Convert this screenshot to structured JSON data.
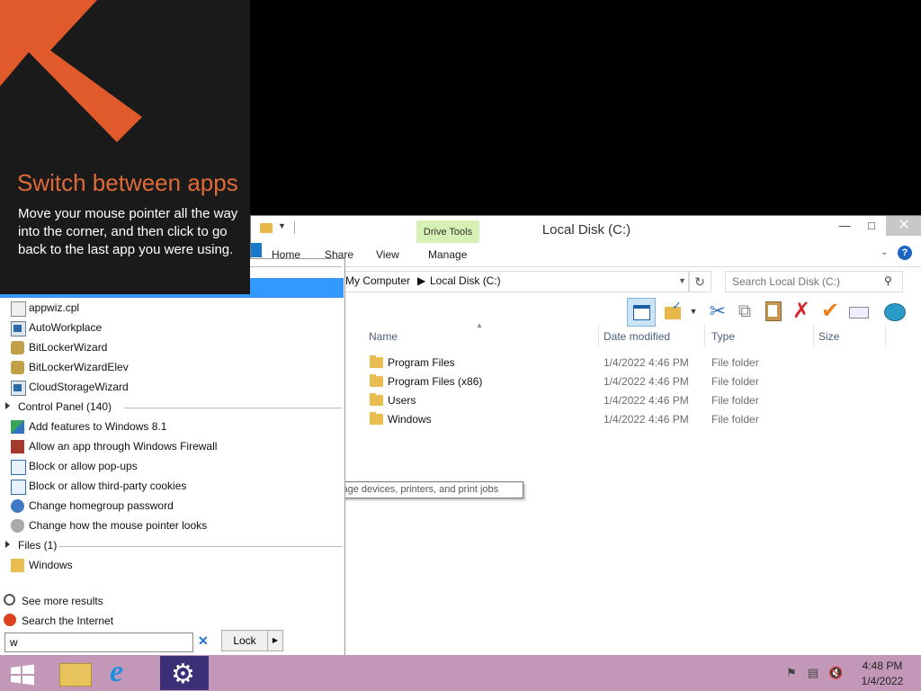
{
  "tip": {
    "title": "Switch between apps",
    "body": "Move your mouse pointer all the way into the corner, and then click to go back to the last app you were using.",
    "accent_color": "#e06a37"
  },
  "explorer": {
    "title": "Local Disk (C:)",
    "contextual_tab": "Drive Tools",
    "tabs": [
      "Home",
      "Share",
      "View",
      "Manage"
    ],
    "address": [
      "My Computer",
      "Local Disk (C:)"
    ],
    "search_placeholder": "Search Local Disk (C:)",
    "columns": [
      "Name",
      "Date modified",
      "Type",
      "Size"
    ],
    "files": [
      {
        "name": "Program Files",
        "date": "1/4/2022 4:46 PM",
        "type": "File folder"
      },
      {
        "name": "Program Files (x86)",
        "date": "1/4/2022 4:46 PM",
        "type": "File folder"
      },
      {
        "name": "Users",
        "date": "1/4/2022 4:46 PM",
        "type": "File folder"
      },
      {
        "name": "Windows",
        "date": "1/4/2022 4:46 PM",
        "type": "File folder"
      }
    ],
    "tooltip": "View and manage devices, printers, and print jobs"
  },
  "flyout": {
    "programs": [
      {
        "label": "appwiz.cpl",
        "icon": "control-panel-file-icon"
      },
      {
        "label": "AutoWorkplace",
        "icon": "app-window-icon"
      },
      {
        "label": "BitLockerWizard",
        "icon": "bitlocker-icon"
      },
      {
        "label": "BitLockerWizardElev",
        "icon": "bitlocker-icon"
      },
      {
        "label": "CloudStorageWizard",
        "icon": "app-window-icon"
      }
    ],
    "control_panel_group": "Control Panel (140)",
    "control_panel": [
      {
        "label": "Add features to Windows 8.1",
        "icon": "windows-features-icon"
      },
      {
        "label": "Allow an app through Windows Firewall",
        "icon": "firewall-icon"
      },
      {
        "label": "Block or allow pop-ups",
        "icon": "popup-blocker-icon"
      },
      {
        "label": "Block or allow third-party cookies",
        "icon": "cookies-icon"
      },
      {
        "label": "Change homegroup password",
        "icon": "homegroup-icon"
      },
      {
        "label": "Change how the mouse pointer looks",
        "icon": "mouse-icon"
      }
    ],
    "files_group": "Files (1)",
    "files": [
      {
        "label": "Windows",
        "icon": "folder-icon"
      }
    ],
    "see_more": "See more results",
    "search_internet": "Search the Internet",
    "search_value": "w",
    "lock_label": "Lock"
  },
  "taskbar": {
    "time": "4:48 PM",
    "date": "1/4/2022",
    "color": "#c297b8"
  }
}
